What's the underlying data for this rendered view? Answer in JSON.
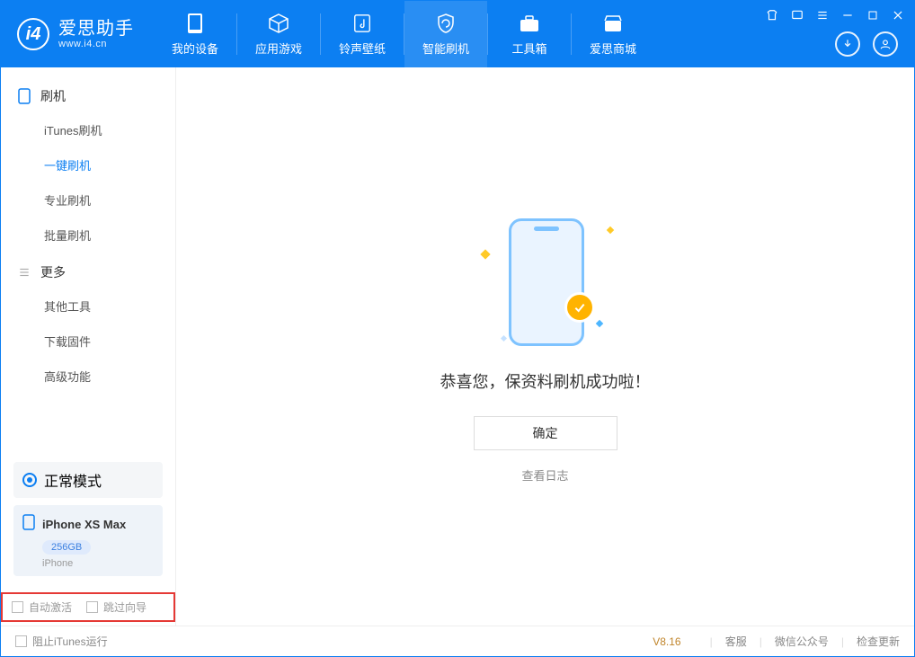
{
  "app": {
    "name": "爱思助手",
    "url": "www.i4.cn"
  },
  "topnav": {
    "items": [
      {
        "label": "我的设备"
      },
      {
        "label": "应用游戏"
      },
      {
        "label": "铃声壁纸"
      },
      {
        "label": "智能刷机"
      },
      {
        "label": "工具箱"
      },
      {
        "label": "爱思商城"
      }
    ]
  },
  "sidebar": {
    "section_flash": "刷机",
    "section_more": "更多",
    "flash_items": [
      {
        "label": "iTunes刷机"
      },
      {
        "label": "一键刷机"
      },
      {
        "label": "专业刷机"
      },
      {
        "label": "批量刷机"
      }
    ],
    "more_items": [
      {
        "label": "其他工具"
      },
      {
        "label": "下载固件"
      },
      {
        "label": "高级功能"
      }
    ],
    "mode_label": "正常模式",
    "device": {
      "name": "iPhone XS Max",
      "storage": "256GB",
      "type": "iPhone"
    },
    "opt_auto_activate": "自动激活",
    "opt_skip_wizard": "跳过向导"
  },
  "main": {
    "success_text": "恭喜您，保资料刷机成功啦！",
    "ok_button": "确定",
    "view_log": "查看日志"
  },
  "footer": {
    "block_itunes": "阻止iTunes运行",
    "version": "V8.16",
    "link_support": "客服",
    "link_wechat": "微信公众号",
    "link_update": "检查更新"
  }
}
